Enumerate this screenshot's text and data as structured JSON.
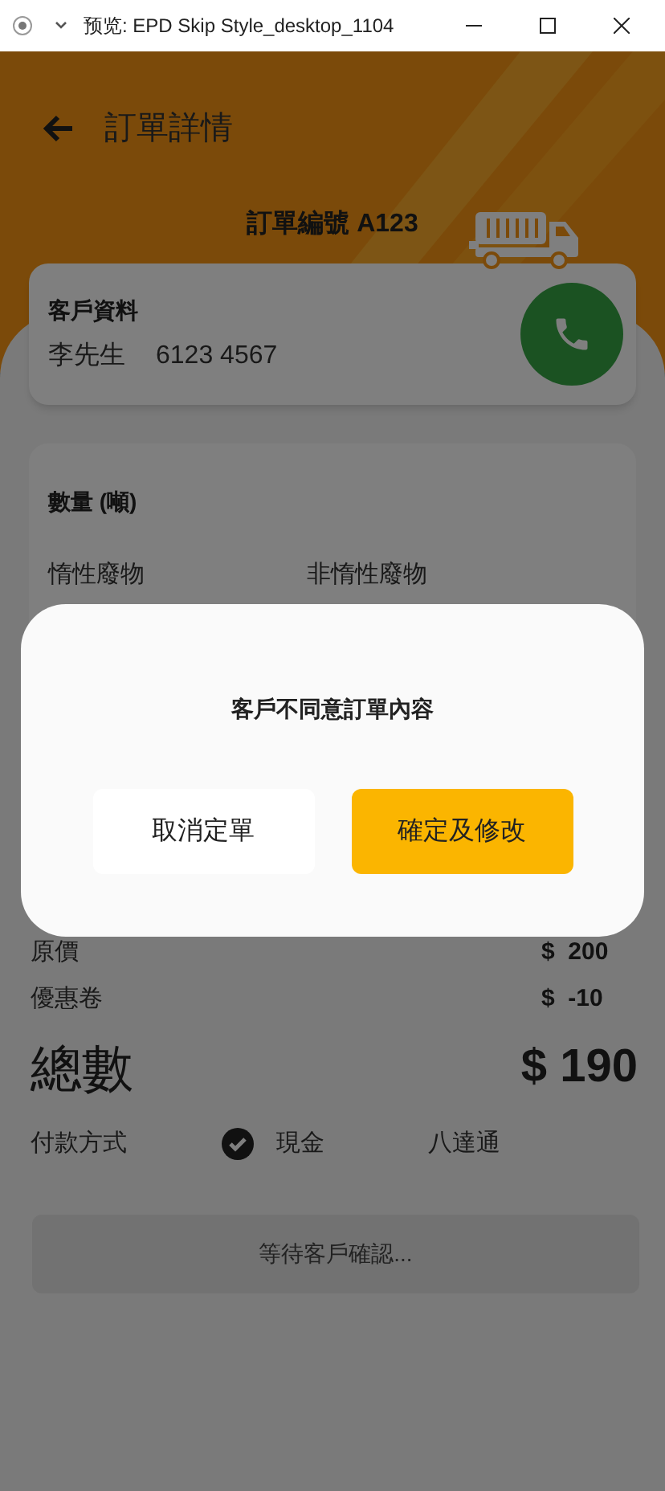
{
  "window": {
    "title": "预览: EPD Skip Style_desktop_1104"
  },
  "header": {
    "title": "訂單詳情",
    "order_number": "訂單編號 A123"
  },
  "customer": {
    "heading": "客戶資料",
    "name": "李先生",
    "phone": "6123 4567"
  },
  "quantity": {
    "heading": "數量 (噸)",
    "columns": [
      "惰性廢物",
      "非惰性廢物"
    ]
  },
  "prices": [
    {
      "label": "原價",
      "amount": "$  200"
    },
    {
      "label": "優惠卷",
      "amount": "$  -10"
    }
  ],
  "total": {
    "label": "總數",
    "amount": "$ 190"
  },
  "payment": {
    "label": "付款方式",
    "options": [
      {
        "label": "現金",
        "selected": true
      },
      {
        "label": "八達通",
        "selected": false
      }
    ]
  },
  "status_button": "等待客戶確認...",
  "dialog": {
    "message": "客戶不同意訂單內容",
    "buttons": [
      {
        "label": "取消定單",
        "kind": "secondary"
      },
      {
        "label": "確定及修改",
        "kind": "primary"
      }
    ]
  }
}
